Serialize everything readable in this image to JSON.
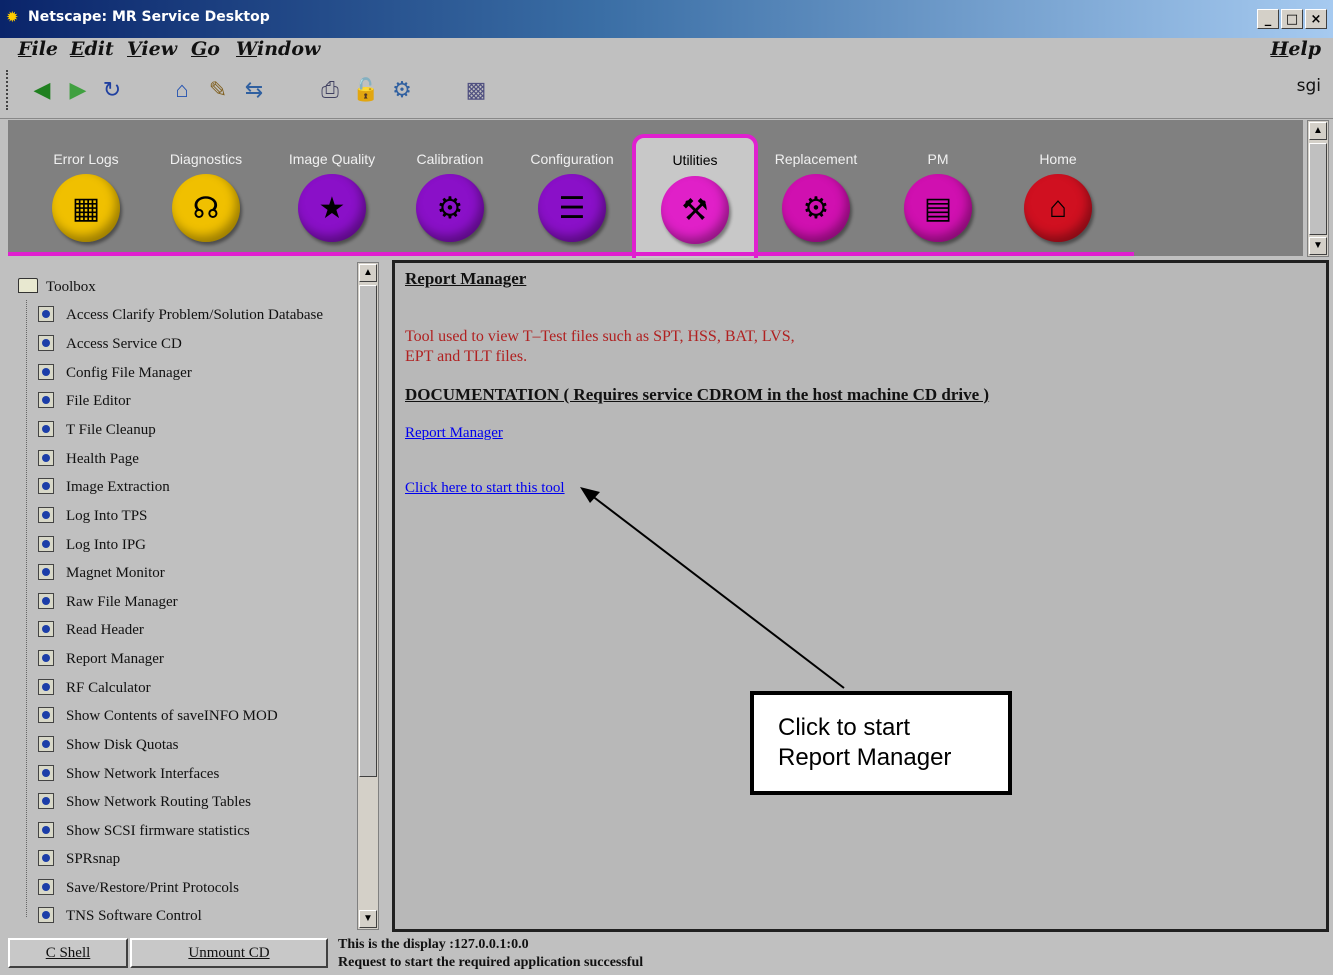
{
  "window": {
    "title": "Netscape: MR Service Desktop"
  },
  "menu": {
    "file": "File",
    "edit": "Edit",
    "view": "View",
    "go": "Go",
    "window": "Window",
    "help": "Help"
  },
  "toolbar": {
    "brand": "sgi"
  },
  "tabs": [
    {
      "label": "Error Logs",
      "color": "#f0c000",
      "icon": "▦"
    },
    {
      "label": "Diagnostics",
      "color": "#f0c000",
      "icon": "☊"
    },
    {
      "label": "Image Quality",
      "color": "#8a10c8",
      "icon": "★"
    },
    {
      "label": "Calibration",
      "color": "#8a10c8",
      "icon": "⚙"
    },
    {
      "label": "Configuration",
      "color": "#8a10c8",
      "icon": "☰"
    },
    {
      "label": "Utilities",
      "color": "#e020c8",
      "icon": "⚒"
    },
    {
      "label": "Replacement",
      "color": "#d010b0",
      "icon": "⚙"
    },
    {
      "label": "PM",
      "color": "#d010b0",
      "icon": "▤"
    },
    {
      "label": "Home",
      "color": "#d01020",
      "icon": "⌂"
    }
  ],
  "sidebar": {
    "root": "Toolbox",
    "items": [
      "Access Clarify Problem/Solution Database",
      "Access Service CD",
      "Config File Manager",
      "File Editor",
      "T File Cleanup",
      "Health Page",
      "Image Extraction",
      "Log Into TPS",
      "Log Into IPG",
      "Magnet Monitor",
      "Raw File Manager",
      "Read Header",
      "Report Manager",
      "RF Calculator",
      "Show Contents of saveINFO MOD",
      "Show Disk Quotas",
      "Show Network Interfaces",
      "Show Network Routing Tables",
      "Show SCSI firmware statistics",
      "SPRsnap",
      "Save/Restore/Print Protocols",
      "TNS Software Control"
    ]
  },
  "content": {
    "title": "Report Manager",
    "description_line1": "Tool used to view T–Test files such as SPT, HSS, BAT, LVS,",
    "description_line2": "EPT and TLT files.",
    "doc_heading": "DOCUMENTATION ( Requires service CDROM in the host machine CD drive )",
    "doc_link": "Report Manager",
    "start_link": "Click here to start this tool",
    "callout_line1": "Click to start",
    "callout_line2": "Report Manager"
  },
  "bottom": {
    "cshell": "C Shell",
    "unmount": "Unmount CD",
    "status_line1": "This is the display :127.0.0.1:0.0",
    "status_line2": "Request to start the required application successful"
  }
}
